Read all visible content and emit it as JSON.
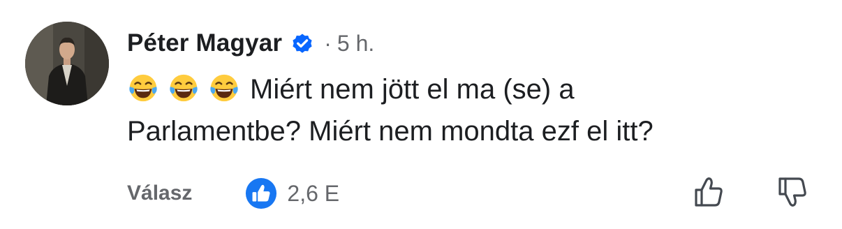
{
  "comment": {
    "author": "Péter Magyar",
    "time_separator": "·",
    "time": "5 h.",
    "emojis": [
      "face-with-tears-of-joy",
      "face-with-tears-of-joy",
      "face-with-tears-of-joy"
    ],
    "text": "Miért nem jött el ma (se) a Parlamentbe? Miért nem mondta ezf el itt?"
  },
  "actions": {
    "reply_label": "Válasz",
    "like_count": "2,6 E"
  },
  "colors": {
    "verified_badge": "#0866ff",
    "like_badge": "#1877f2",
    "muted_text": "#65676b"
  },
  "icons": {
    "verified": "verified-badge-icon",
    "like": "thumbs-up-icon",
    "upvote": "thumbs-up-outline-icon",
    "downvote": "thumbs-down-outline-icon"
  }
}
